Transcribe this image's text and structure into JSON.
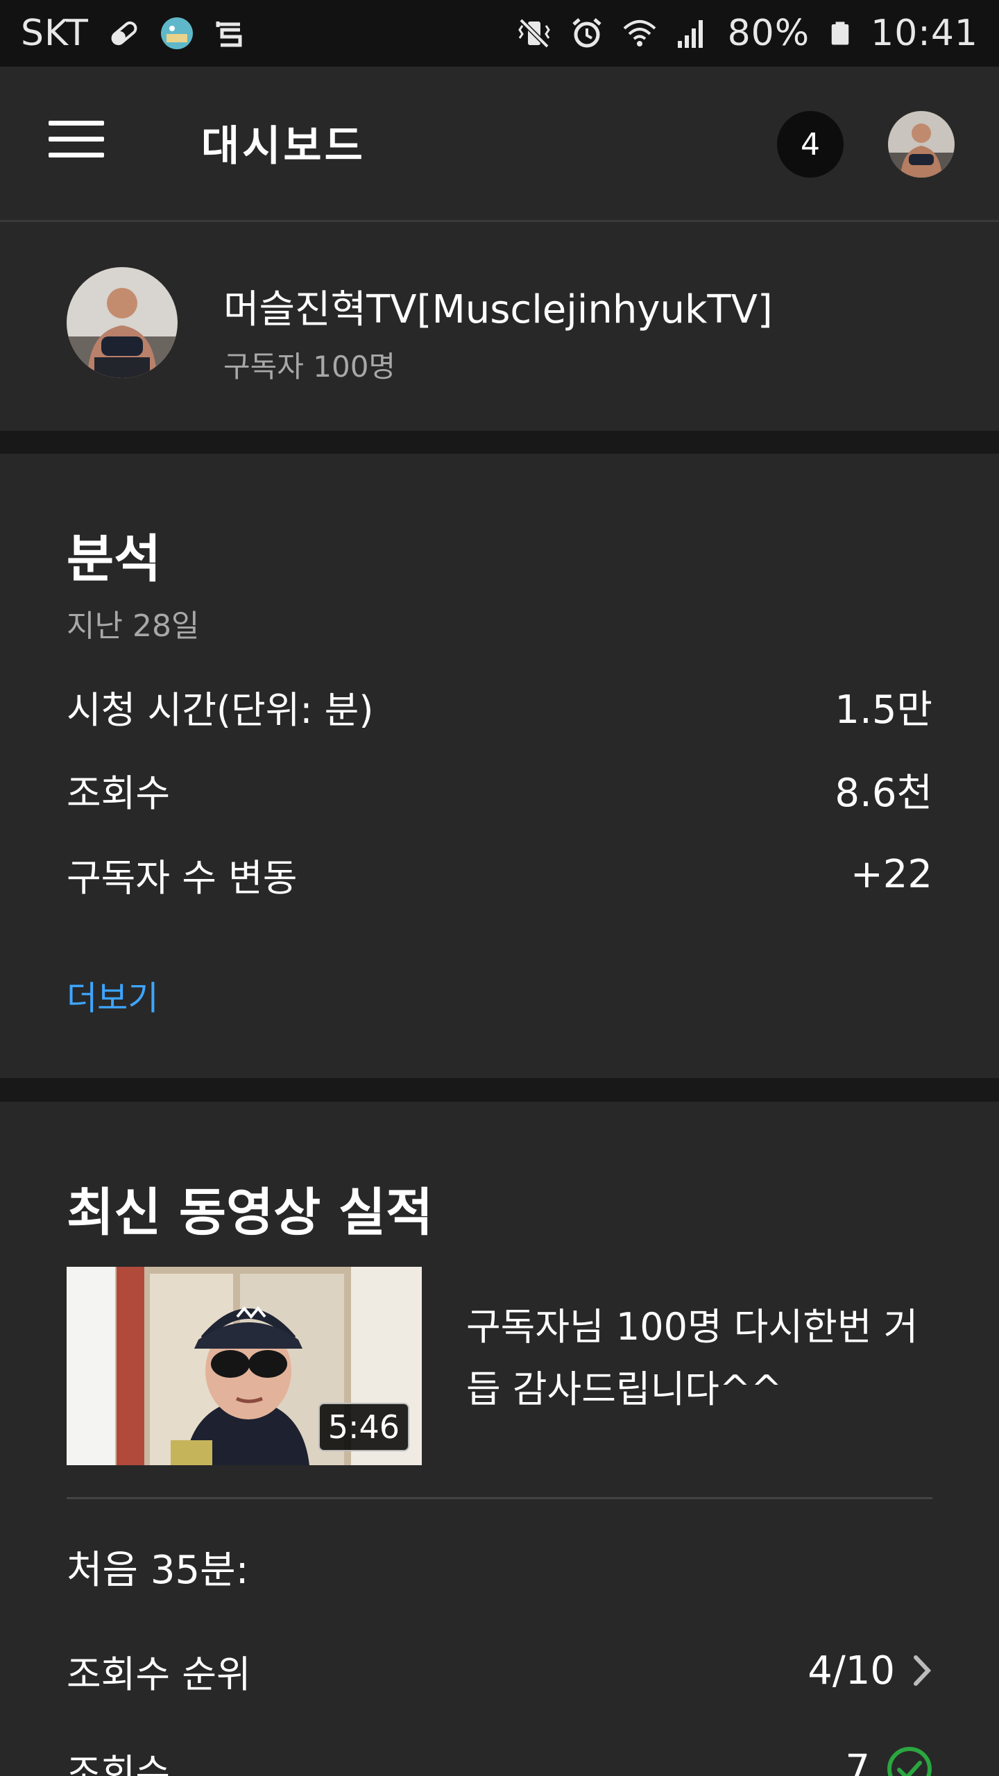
{
  "status_bar": {
    "carrier": "SKT",
    "battery": "80%",
    "time": "10:41"
  },
  "app_bar": {
    "title": "대시보드",
    "notification_count": "4"
  },
  "channel": {
    "name": "머슬진혁TV[MusclejinhyukTV]",
    "subscribers": "구독자 100명"
  },
  "analytics": {
    "title": "분석",
    "period": "지난 28일",
    "metrics": [
      {
        "label": "시청 시간(단위: 분)",
        "value": "1.5만"
      },
      {
        "label": "조회수",
        "value": "8.6천"
      },
      {
        "label": "구독자 수 변동",
        "value": "+22"
      }
    ],
    "more_label": "더보기"
  },
  "latest_video": {
    "section_title": "최신 동영상 실적",
    "duration": "5:46",
    "title": "구독자님 100명 다시한번 거듭 감사드립니다^^",
    "first_period_label": "처음 35분:",
    "rows": [
      {
        "label": "조회수 순위",
        "value": "4/10"
      },
      {
        "label": "조회수",
        "value": "7"
      }
    ]
  },
  "colors": {
    "background": "#282828",
    "status_bar": "#121212",
    "link": "#3ea6ff",
    "success": "#2ba640"
  }
}
